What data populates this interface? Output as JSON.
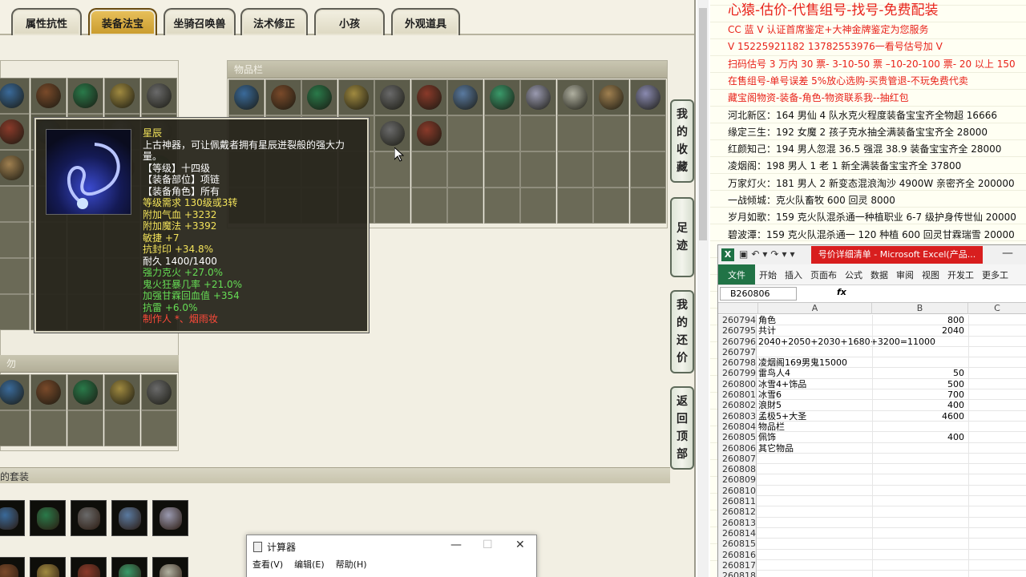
{
  "tabs": [
    {
      "label": "属性抗性",
      "active": false
    },
    {
      "label": "装备法宝",
      "active": true
    },
    {
      "label": "坐骑召唤兽",
      "active": false
    },
    {
      "label": "法术修正",
      "active": false
    },
    {
      "label": "小孩",
      "active": false
    },
    {
      "label": "外观道具",
      "active": false
    }
  ],
  "inventory": {
    "title": "物品栏"
  },
  "bottom_sections": {
    "left_label": "勿",
    "suit_label": "的套装"
  },
  "side_buttons": [
    {
      "chars": [
        "我",
        "的",
        "收",
        "藏"
      ]
    },
    {
      "chars": [
        "足",
        "迹"
      ]
    },
    {
      "chars": [
        "我",
        "的",
        "还",
        "价"
      ]
    },
    {
      "chars": [
        "返",
        "回",
        "顶",
        "部"
      ]
    }
  ],
  "tooltip": {
    "name": "星辰",
    "desc": "上古神器，可让佩戴者拥有星辰迸裂般的强大力量。",
    "level": "【等级】十四级",
    "slot": "【装备部位】项链",
    "role": "【装备角色】所有",
    "req": "等级需求 130级或3转",
    "hp": "附加气血 +3232",
    "mp": "附加魔法 +3392",
    "agi": "敏捷 +7",
    "seal": "抗封印 +34.8%",
    "dur": "耐久 1400/1400",
    "fire": "强力克火 +27.0%",
    "ghost": "鬼火狂暴几率 +21.0%",
    "heal": "加强甘霖回血值 +354",
    "thunder": "抗雷 +6.0%",
    "maker": "制作人 *、烟雨妆"
  },
  "calculator": {
    "title": "计算器",
    "menu": [
      "查看(V)",
      "编辑(E)",
      "帮助(H)"
    ],
    "min": "—",
    "max": "☐",
    "close": "✕"
  },
  "ad": {
    "headline": "心猿-估价-代售组号-找号-免费配装",
    "lines": [
      {
        "text": "CC 蓝 V 认证首席鉴定+大神金牌鉴定为您服务",
        "color": "red"
      },
      {
        "text": "V 15225921182      13782553976一看号估号加 V",
        "color": "red"
      },
      {
        "text": "扫码估号 3 万内 30 票- 3-10-50 票  –10-20-100 票- 20 以上 150",
        "color": "red"
      },
      {
        "text": "在售组号-单号误差 5%放心选购-买贵管退-不玩免费代卖",
        "color": "red"
      },
      {
        "text": "藏宝阁物资-装备-角色-物资联系我--抽红包",
        "color": "red"
      },
      {
        "text": "河北新区：164 男仙 4 队水克火程度装备宝宝齐全物超 16666",
        "color": "blk"
      },
      {
        "text": "缘定三生：192 女魔 2 孩子克水抽全满装备宝宝齐全 28000",
        "color": "blk"
      },
      {
        "text": "红颜知己：194 男人忽混 36.5 强混 38.9 装备宝宝齐全 28000",
        "color": "blk"
      },
      {
        "text": "凌烟阁：198 男人 1 老 1 新全满装备宝宝齐全 37800",
        "color": "blk"
      },
      {
        "text": "万家灯火：181 男人 2 新变态混浪淘沙 4900W 亲密齐全 200000",
        "color": "blk"
      },
      {
        "text": "一战倾城：克火队畜牧 600 回灵 8000",
        "color": "blk"
      },
      {
        "text": "岁月如歌：159 克火队混杀通一种植职业 6-7 级护身传世仙 20000",
        "color": "blk"
      },
      {
        "text": "碧波潭：159 克火队混杀通一 120 种植 600 回灵甘霖瑞雪 20000",
        "color": "blk"
      }
    ]
  },
  "excel": {
    "window_title": "号价详细清单 - Microsoft Excel(产品...",
    "ribbon_tabs": [
      "文件",
      "开始",
      "插入",
      "页面布",
      "公式",
      "数据",
      "审阅",
      "视图",
      "开发工",
      "更多工"
    ],
    "name_box": "B260806",
    "fx": "fx",
    "columns": [
      "A",
      "B",
      "C"
    ],
    "rows": [
      {
        "n": "260794",
        "a": "角色",
        "b": "800"
      },
      {
        "n": "260795",
        "a": "共计",
        "b": "2040"
      },
      {
        "n": "260796",
        "a": "2040+2050+2030+1680+3200=11000",
        "b": ""
      },
      {
        "n": "260797",
        "a": "",
        "b": ""
      },
      {
        "n": "260798",
        "a": "凌烟阁169男鬼15000",
        "b": ""
      },
      {
        "n": "260799",
        "a": "雷鸟人4",
        "b": "50"
      },
      {
        "n": "260800",
        "a": "冰雪4+饰品",
        "b": "500"
      },
      {
        "n": "260801",
        "a": "冰雪6",
        "b": "700"
      },
      {
        "n": "260802",
        "a": "浪財5",
        "b": "400"
      },
      {
        "n": "260803",
        "a": "孟极5+大圣",
        "b": "4600"
      },
      {
        "n": "260804",
        "a": "物品栏",
        "b": ""
      },
      {
        "n": "260805",
        "a": "佩饰",
        "b": "400"
      },
      {
        "n": "260806",
        "a": "其它物品",
        "b": ""
      },
      {
        "n": "260807",
        "a": "",
        "b": ""
      },
      {
        "n": "260808",
        "a": "",
        "b": ""
      },
      {
        "n": "260809",
        "a": "",
        "b": ""
      },
      {
        "n": "260810",
        "a": "",
        "b": ""
      },
      {
        "n": "260811",
        "a": "",
        "b": ""
      },
      {
        "n": "260812",
        "a": "",
        "b": ""
      },
      {
        "n": "260813",
        "a": "",
        "b": ""
      },
      {
        "n": "260814",
        "a": "",
        "b": ""
      },
      {
        "n": "260815",
        "a": "",
        "b": ""
      },
      {
        "n": "260816",
        "a": "",
        "b": ""
      },
      {
        "n": "260817",
        "a": "",
        "b": ""
      },
      {
        "n": "260818",
        "a": "",
        "b": ""
      }
    ]
  }
}
